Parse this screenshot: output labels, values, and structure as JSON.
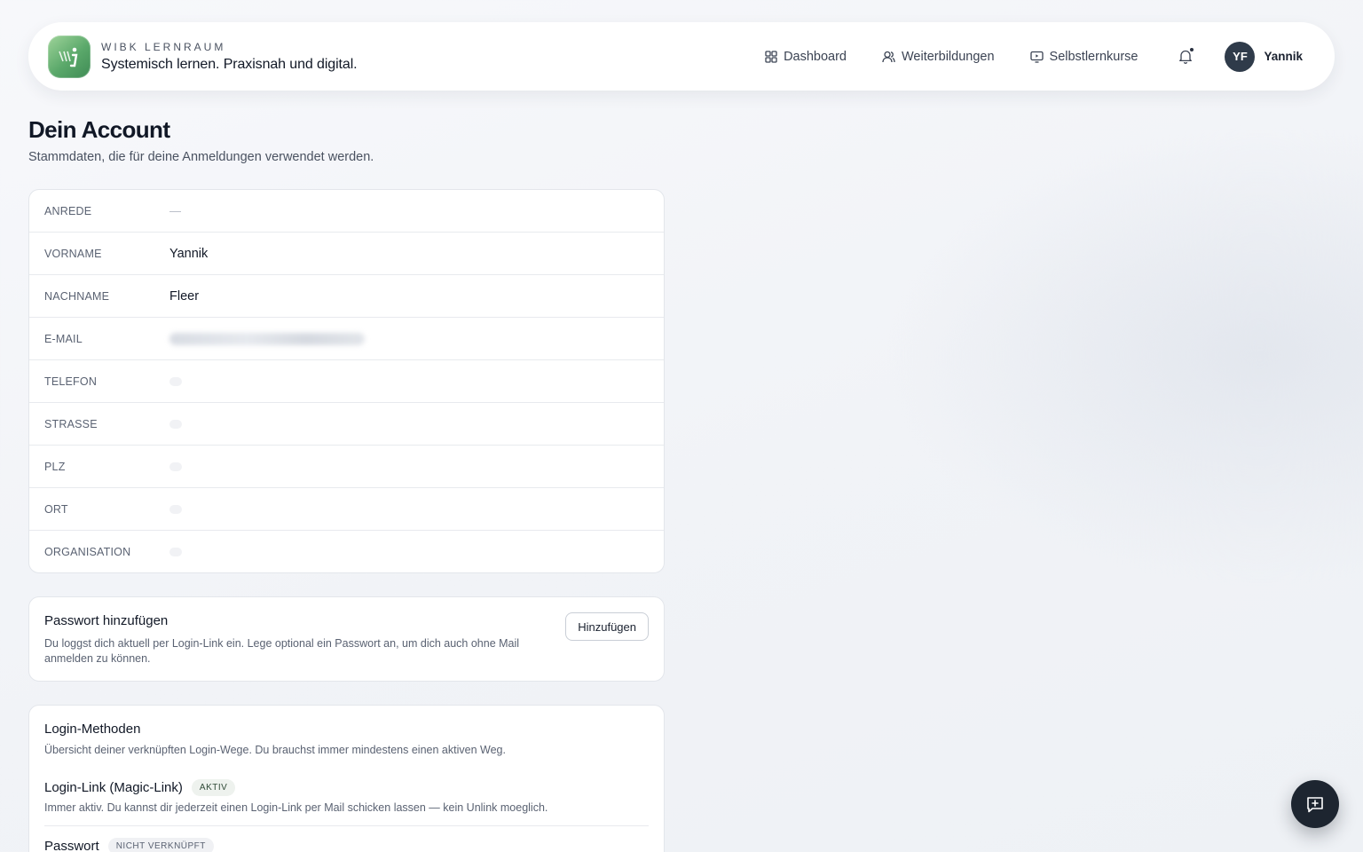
{
  "header": {
    "brand_top": "WIBK LERNRAUM",
    "brand_subtitle": "Systemisch lernen. Praxisnah und digital.",
    "nav": [
      {
        "label": "Dashboard",
        "icon": "grid-icon"
      },
      {
        "label": "Weiterbildungen",
        "icon": "users-icon"
      },
      {
        "label": "Selbstlernkurse",
        "icon": "monitor-play-icon"
      }
    ],
    "user": {
      "initials": "YF",
      "name": "Yannik"
    }
  },
  "page": {
    "title": "Dein Account",
    "subtitle": "Stammdaten, die für deine Anmeldungen verwendet werden."
  },
  "fields": [
    {
      "label": "ANREDE",
      "value": "—"
    },
    {
      "label": "VORNAME",
      "value": "Yannik"
    },
    {
      "label": "NACHNAME",
      "value": "Fleer"
    },
    {
      "label": "E-MAIL",
      "value": ""
    },
    {
      "label": "TELEFON",
      "value": ""
    },
    {
      "label": "STRASSE",
      "value": ""
    },
    {
      "label": "PLZ",
      "value": ""
    },
    {
      "label": "ORT",
      "value": ""
    },
    {
      "label": "ORGANISATION",
      "value": ""
    }
  ],
  "password_card": {
    "title": "Passwort hinzufügen",
    "description": "Du loggst dich aktuell per Login-Link ein. Lege optional ein Passwort an, um dich auch ohne Mail anmelden zu können.",
    "button_label": "Hinzufügen"
  },
  "login_methods": {
    "title": "Login-Methoden",
    "description": "Übersicht deiner verknüpften Login-Wege. Du brauchst immer mindestens einen aktiven Weg.",
    "methods": [
      {
        "name": "Login-Link (Magic-Link)",
        "badge": "AKTIV",
        "description": "Immer aktiv. Du kannst dir jederzeit einen Login-Link per Mail schicken lassen — kein Unlink moeglich."
      },
      {
        "name": "Passwort",
        "badge": "NICHT VERKNÜPFT",
        "description": ""
      }
    ]
  },
  "colors": {
    "accent_dark": "#1d2530",
    "logo_green": "#5aa86a",
    "avatar_bg": "#2f3b4a"
  }
}
